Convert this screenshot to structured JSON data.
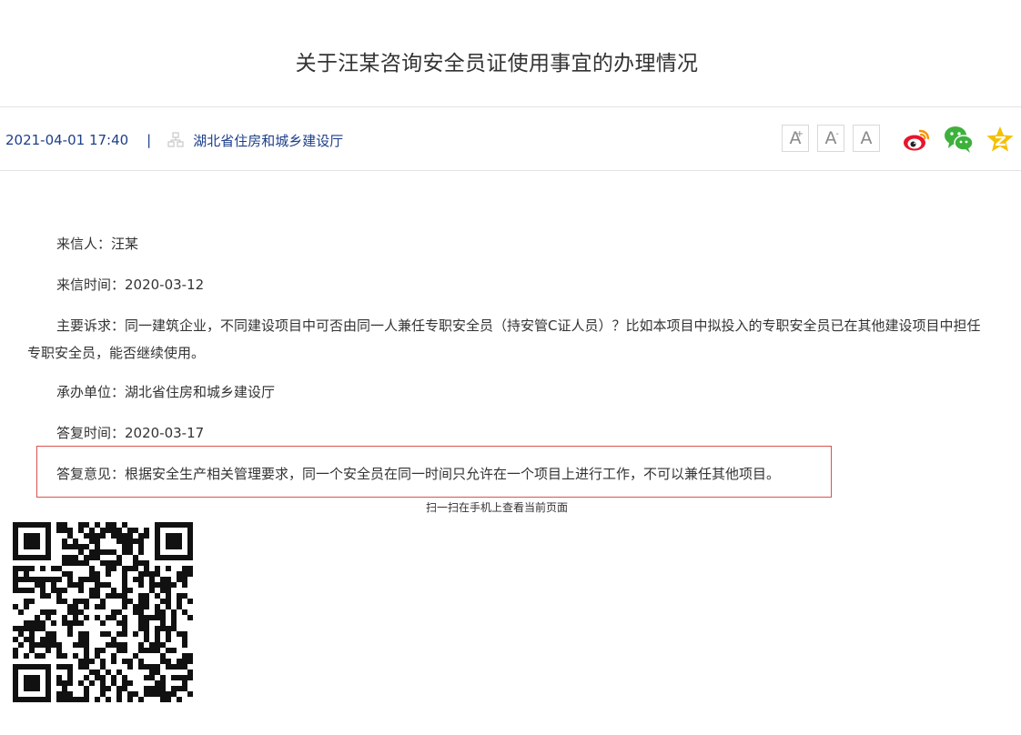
{
  "article": {
    "title": "关于汪某咨询安全员证使用事宜的办理情况",
    "date": "2021-04-01 17:40",
    "separator": "|",
    "source": "湖北省住房和城乡建设厅"
  },
  "font_controls": {
    "increase": "A",
    "increase_mark": "+",
    "decrease": "A",
    "decrease_mark": "-",
    "reset": "A"
  },
  "share": {
    "icons": [
      "weibo-icon",
      "wechat-icon",
      "qzone-icon"
    ],
    "colors": {
      "weibo": "#e6162d",
      "weibo_accent": "#f79400",
      "wechat": "#3db13c",
      "qzone": "#f5c000"
    }
  },
  "content": {
    "sender": "来信人：汪某",
    "letter_date": "来信时间：2020-03-12",
    "appeal": "主要诉求：同一建筑企业，不同建设项目中可否由同一人兼任专职安全员（持安管C证人员）？比如本项目中拟投入的专职安全员已在其他建设项目中担任专职安全员，能否继续使用。",
    "handler": "承办单位：湖北省住房和城乡建设厅",
    "reply_date": "答复时间：2020-03-17",
    "reply": "答复意见：根据安全生产相关管理要求，同一个安全员在同一时间只允许在一个项目上进行工作，不可以兼任其他项目。"
  },
  "qr": {
    "caption": "扫一扫在手机上查看当前页面"
  },
  "colors": {
    "meta_text": "#1d3f8a",
    "highlight_border": "#d9534f",
    "divider": "#e3e3e3"
  }
}
